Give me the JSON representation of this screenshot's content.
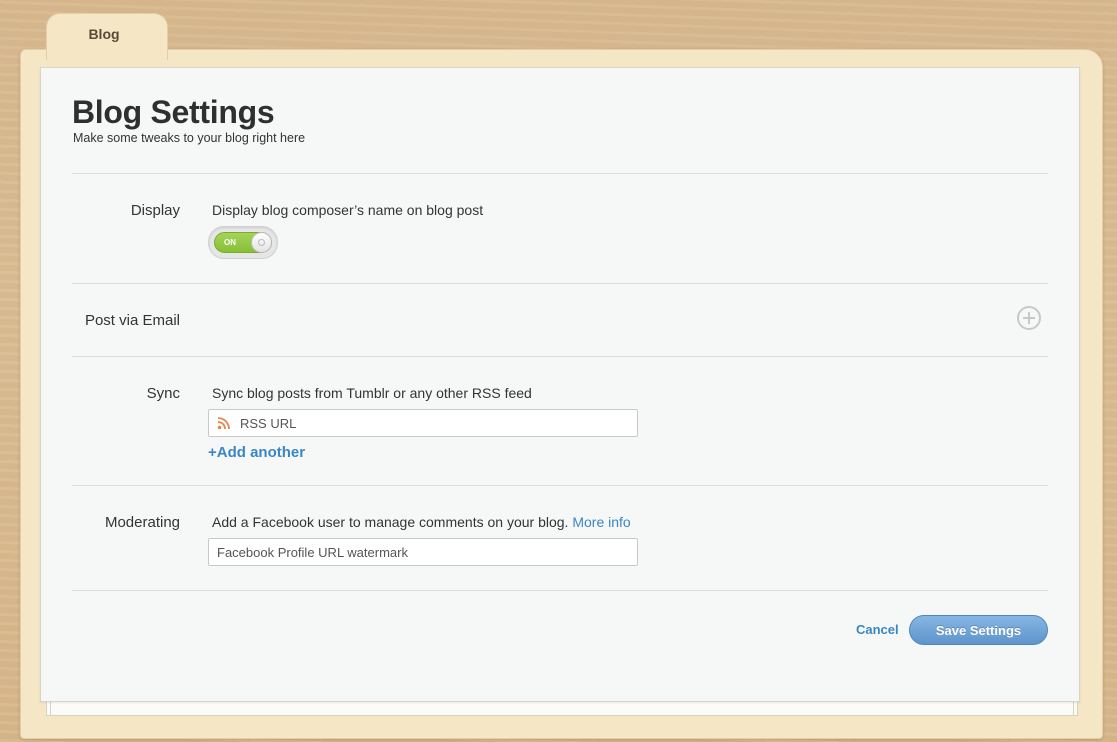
{
  "tab": {
    "label": "Blog"
  },
  "header": {
    "title": "Blog Settings",
    "subtitle": "Make some tweaks to your blog right here"
  },
  "display": {
    "label": "Display",
    "description": "Display blog composer’s name on blog post",
    "toggle_state": "ON"
  },
  "post_via_email": {
    "label": "Post via Email",
    "icon": "plus-circle-icon"
  },
  "sync": {
    "label": "Sync",
    "description": "Sync blog posts from Tumblr or any other RSS feed",
    "rss_placeholder": "RSS URL",
    "rss_value": "",
    "add_another": "+Add another",
    "icon": "rss-icon"
  },
  "moderating": {
    "label": "Moderating",
    "description": "Add a Facebook user to manage comments on your blog.",
    "more_info": "More info",
    "facebook_placeholder": "Facebook Profile URL watermark",
    "facebook_value": ""
  },
  "actions": {
    "cancel": "Cancel",
    "save": "Save Settings"
  },
  "colors": {
    "accent": "#3a86c4",
    "toggle_on": "#8cc63f",
    "save_button": "#6a9fd4",
    "folder": "#f5e6c6"
  }
}
